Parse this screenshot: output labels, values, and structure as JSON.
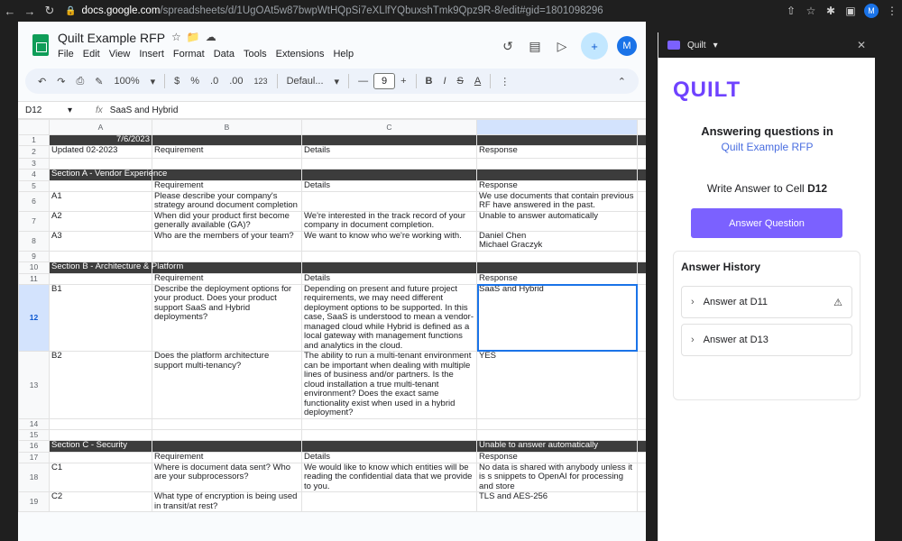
{
  "browser": {
    "url_host": "docs.google.com",
    "url_path": "/spreadsheets/d/1UgOAt5w87bwpWtHQpSi7eXLlfYQbuxshTmk9Qpz9R-8/edit#gid=1801098296",
    "profile_initial": "M"
  },
  "sheets": {
    "title": "Quilt Example RFP",
    "menu": [
      "File",
      "Edit",
      "View",
      "Insert",
      "Format",
      "Data",
      "Tools",
      "Extensions",
      "Help"
    ],
    "user_initial": "M",
    "toolbar": {
      "zoom": "100%",
      "currency": "$",
      "percent": "%",
      "dec_decrease": ".0",
      "dec_increase": ".00",
      "number_format": "123",
      "font": "Defaul...",
      "font_size": "9"
    },
    "name_box": "D12",
    "formula": "SaaS and Hybrid",
    "columns": [
      "A",
      "B",
      "C",
      ""
    ],
    "rows": [
      {
        "num": "1",
        "a": "7/6/2023",
        "b": "",
        "c": "",
        "d": "",
        "dark": true,
        "a_right": true
      },
      {
        "num": "2",
        "a": "Updated 02-2023",
        "b": "Requirement",
        "c": "Details",
        "d": "Response"
      },
      {
        "num": "3",
        "a": "",
        "b": "",
        "c": "",
        "d": ""
      },
      {
        "num": "4",
        "a": "Section A - Vendor Experience",
        "b": "",
        "c": "",
        "d": "",
        "dark": true
      },
      {
        "num": "5",
        "a": "",
        "b": "Requirement",
        "c": "Details",
        "d": "Response"
      },
      {
        "num": "6",
        "a": "A1",
        "b": "Please describe your company's strategy around document completion",
        "c": "",
        "d": "We use documents that contain previous RF have answered in the past."
      },
      {
        "num": "7",
        "a": "A2",
        "b": "When did your product first become generally available (GA)?",
        "c": "We're interested in the track record of your company in document completion.",
        "d": "Unable to answer automatically"
      },
      {
        "num": "8",
        "a": "A3",
        "b": "Who are the members of your team?",
        "c": "We want to know who we're working with.",
        "d": "Daniel Chen\nMichael Graczyk"
      },
      {
        "num": "9",
        "a": "",
        "b": "",
        "c": "",
        "d": ""
      },
      {
        "num": "10",
        "a": "Section B - Architecture & Platform",
        "b": "",
        "c": "",
        "d": "",
        "dark": true
      },
      {
        "num": "11",
        "a": "",
        "b": "Requirement",
        "c": "Details",
        "d": "Response"
      },
      {
        "num": "12",
        "a": "B1",
        "b": "Describe the deployment options for your product. Does your product support SaaS and Hybrid deployments?",
        "c": "Depending on present and future project requirements, we may need different deployment options to be supported. In this case, SaaS is understood to mean a vendor-managed cloud while Hybrid is defined as a local gateway with management functions and analytics in the cloud.",
        "d": "SaaS and Hybrid",
        "selected": true
      },
      {
        "num": "13",
        "a": "B2",
        "b": "Does the platform architecture support multi-tenancy?",
        "c": "The ability to run a multi-tenant environment can be important when dealing with multiple lines of business and/or partners. Is the cloud installation a true multi-tenant environment? Does the exact same functionality exist when used in a hybrid deployment?",
        "d": "YES"
      },
      {
        "num": "14",
        "a": "",
        "b": "",
        "c": "",
        "d": ""
      },
      {
        "num": "15",
        "a": "",
        "b": "",
        "c": "",
        "d": ""
      },
      {
        "num": "16",
        "a": "Section C - Security",
        "b": "",
        "c": "",
        "d": "Unable to answer automatically",
        "dark": true
      },
      {
        "num": "17",
        "a": "",
        "b": "Requirement",
        "c": "Details",
        "d": "Response"
      },
      {
        "num": "18",
        "a": "C1",
        "b": "Where is document data sent? Who are your subprocessors?",
        "c": "We would like to know which entities will be reading the confidential data that we provide to you.",
        "d": "No data is shared with anybody unless it is s snippets to OpenAI for processing and store"
      },
      {
        "num": "19",
        "a": "C2",
        "b": "What type of encryption is being used in transit/at rest?",
        "c": "",
        "d": "TLS and AES-256"
      }
    ]
  },
  "quilt": {
    "tab_label": "Quilt",
    "logo": "QUILT",
    "answering_label": "Answering questions in",
    "doc_name": "Quilt Example RFP",
    "write_prefix": "Write Answer to Cell",
    "write_cell": "D12",
    "button_label": "Answer Question",
    "history_title": "Answer History",
    "history": [
      {
        "label": "Answer at D11",
        "warning": true
      },
      {
        "label": "Answer at D13",
        "warning": false
      }
    ]
  }
}
